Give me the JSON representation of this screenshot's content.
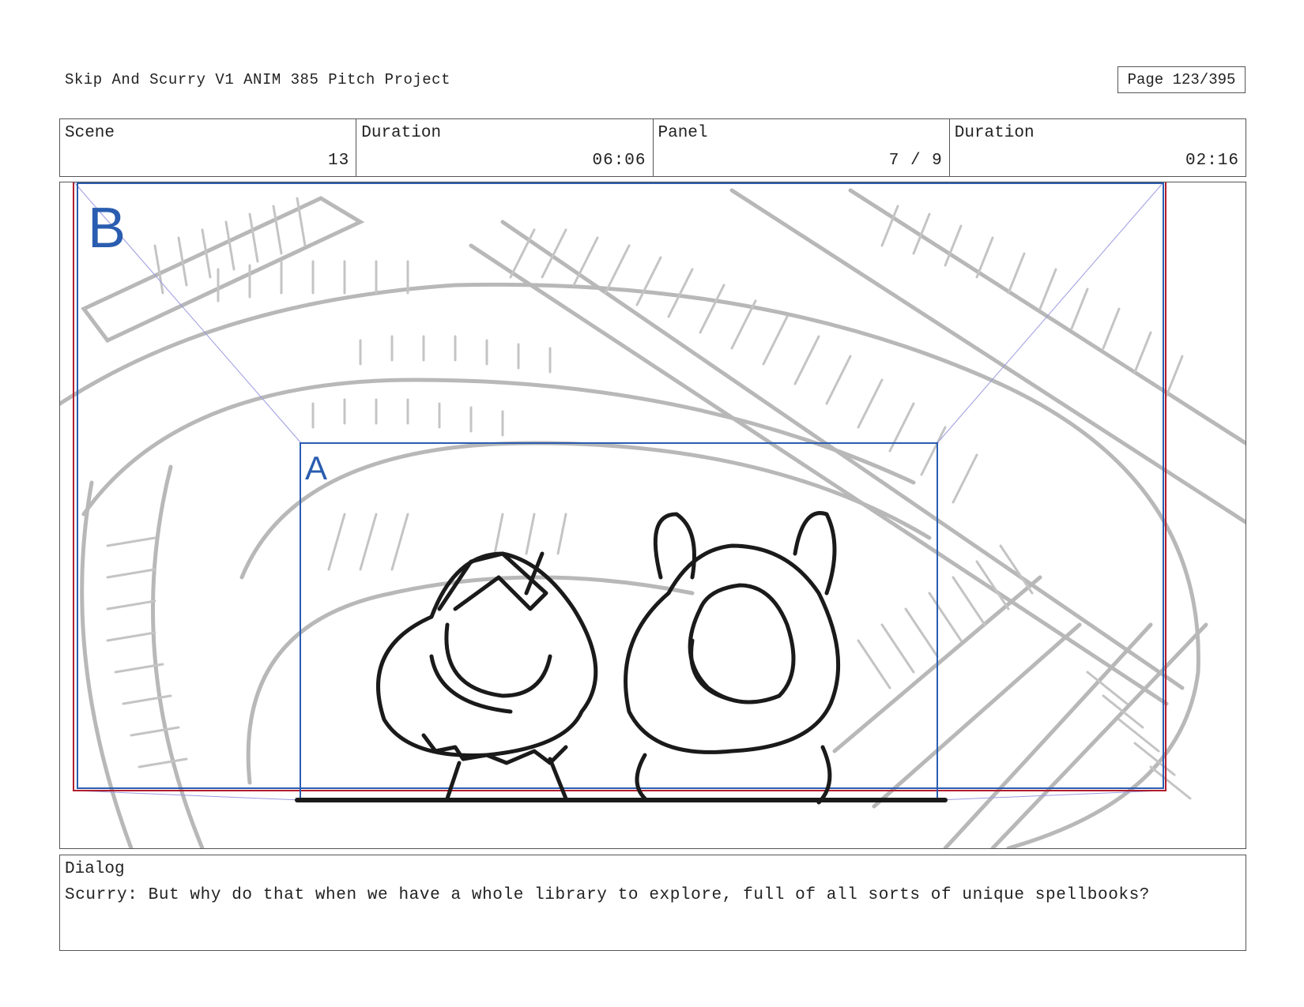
{
  "header": {
    "project_title": "Skip And Scurry V1  ANIM 385 Pitch Project",
    "page_indicator": "Page 123/395"
  },
  "info_table": {
    "scene_label": "Scene",
    "scene_value": "13",
    "scene_duration_label": "Duration",
    "scene_duration_value": "06:06",
    "panel_label": "Panel",
    "panel_value": "7 / 9",
    "panel_duration_label": "Duration",
    "panel_duration_value": "02:16"
  },
  "panel": {
    "frame_b_label": "B",
    "frame_a_label": "A",
    "frame_color": "#2a5db0",
    "safe_color": "#b01e2e",
    "sketch_color": "#b5b5b5"
  },
  "dialog": {
    "label": "Dialog",
    "text": "Scurry: But why do that when we have a whole library to explore, full of all sorts of unique spellbooks?"
  }
}
